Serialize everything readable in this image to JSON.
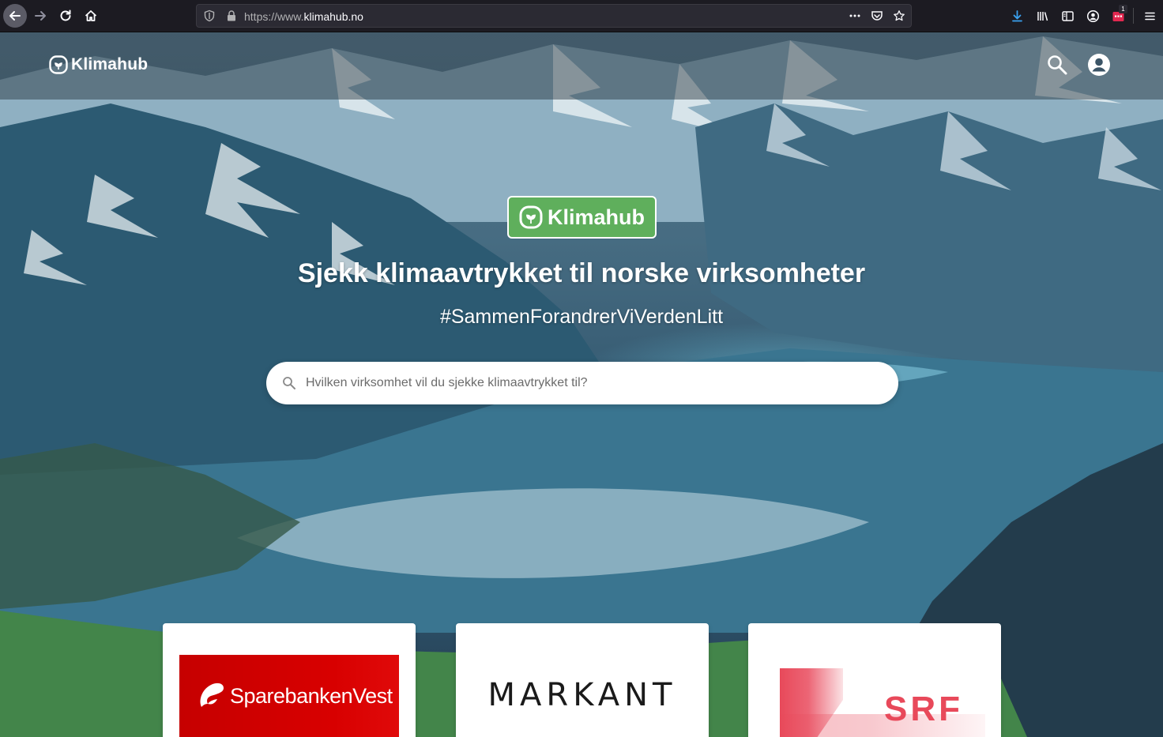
{
  "browser": {
    "url_prefix": "https://www.",
    "url_host": "klimahub.no",
    "extension_badge": "1"
  },
  "header": {
    "logo_text": "Klimahub"
  },
  "hero": {
    "badge_text": "Klimahub",
    "title": "Sjekk klimaavtrykket til norske virksomheter",
    "hashtag": "#SammenForandrerViVerdenLitt",
    "search_placeholder": "Hvilken virksomhet vil du sjekke klimaavtrykket til?"
  },
  "companies": [
    {
      "name": "SparebankenVest"
    },
    {
      "name": "MARKANT"
    },
    {
      "name": "SRF"
    }
  ],
  "colors": {
    "brand_green": "#5faf5c",
    "band_green": "#43854a",
    "sbv_red": "#d40000",
    "srf_pink": "#e8495a"
  }
}
